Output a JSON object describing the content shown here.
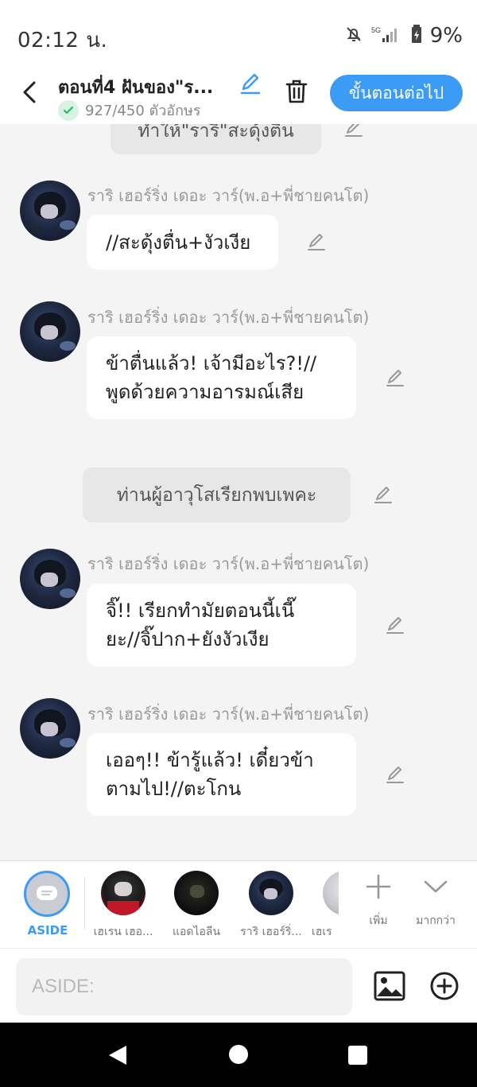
{
  "status_bar": {
    "time": "02:12 น.",
    "network": "5G",
    "battery_pct": "9%",
    "icons": [
      "bell-off-icon",
      "signal-icon",
      "battery-icon"
    ]
  },
  "header": {
    "back_icon": "chevron-left-icon",
    "title": "ตอนที่4 ฝันของ\"ร...",
    "char_count": "927/450 ตัวอักษร",
    "edit_icon": "pencil-icon",
    "delete_icon": "trash-icon",
    "next_label": "ขั้นตอนต่อไป",
    "accent": "#3b9bf5"
  },
  "chat": {
    "top_narration": "ทำให้\"ราริ\"สะดุ้งตื่น",
    "messages": [
      {
        "speaker": "ราริ เฮอร์ริ่ง เดอะ วาร์(พ.อ+พี่ชายคนโต)",
        "text": "//สะดุ้งตื่น+งัวเงีย"
      },
      {
        "speaker": "ราริ เฮอร์ริ่ง เดอะ วาร์(พ.อ+พี่ชายคนโต)",
        "text": "ข้าตื่นแล้ว! เจ้ามีอะไร?!//\nพูดด้วยความอารมณ์เสีย"
      },
      {
        "speaker": "ราริ เฮอร์ริ่ง เดอะ วาร์(พ.อ+พี่ชายคนโต)",
        "text": "จิ๊!! เรียกทำมัยตอนนี้เนี๊\nยะ//จิ๊ปาก+ยังงัวเงีย"
      },
      {
        "speaker": "ราริ เฮอร์ริ่ง เดอะ วาร์(พ.อ+พี่ชายคนโต)",
        "text": "เออๆ!! ข้ารู้แล้ว! เดี๋ยวข้า\nตามไป!//ตะโกน"
      }
    ],
    "narration": "ท่านผู้อาวุโสเรียกพบเพคะ"
  },
  "character_bar": {
    "aside_label": "ASIDE",
    "characters": [
      {
        "label": "เฮเรน เฮอ..."
      },
      {
        "label": "แอดไอลีน"
      },
      {
        "label": "ราริ เฮอร์ริ่..."
      },
      {
        "label": "เฮเร"
      }
    ],
    "add_label": "เพิ่ม",
    "more_label": "มากกว่า"
  },
  "input_bar": {
    "placeholder": "ASIDE:",
    "image_icon": "image-icon",
    "add_icon": "plus-circle-icon"
  },
  "nav_bar": {
    "icons": [
      "back-triangle-icon",
      "home-circle-icon",
      "recents-square-icon"
    ]
  }
}
